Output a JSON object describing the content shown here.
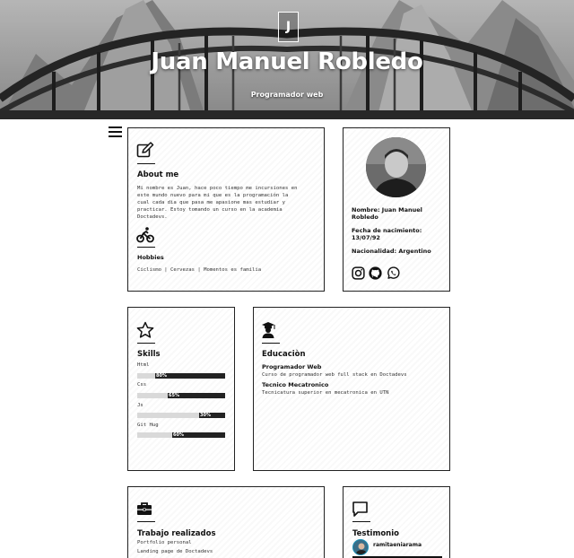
{
  "hero": {
    "logo_letter": "J",
    "title": "Juan Manuel Robledo",
    "subtitle": "Programador web"
  },
  "menu": {
    "icon": "hamburger-menu-icon"
  },
  "about": {
    "icon": "pencil-square-icon",
    "title": "About me",
    "text": [
      "Mi nombre es Juan, hace poco tiempo me incursiones en",
      "este mundo nuevo para mi que es la programación la",
      "cual cada dia que pasa me apasione mas estudiar y",
      "practicar. Estoy tomando un curso en la academia",
      "Doctadevs."
    ],
    "hobbies_icon": "bicycle-rider-icon",
    "hobbies_title": "Hobbies",
    "hobbies_text": "Ciclismo | Cervezas | Momentos es familia"
  },
  "profile": {
    "name_label": "Nombre: Juan Manuel",
    "name_label_2": "Robledo",
    "birth_label": "Fecha de nacimiento:",
    "birth_value": "13/07/92",
    "nationality": "Nacionalidad: Argentino",
    "socials": [
      "instagram-icon",
      "github-icon",
      "whatsapp-icon"
    ]
  },
  "skills": {
    "icon": "star-outline-icon",
    "title": "Skills",
    "items": [
      {
        "name": "Html",
        "percent": 80,
        "label": "80%"
      },
      {
        "name": "Css",
        "percent": 65,
        "label": "65%"
      },
      {
        "name": "Js",
        "percent": 30,
        "label": "30%"
      },
      {
        "name": "Git Hug",
        "percent": 60,
        "label": "60%"
      }
    ]
  },
  "education": {
    "icon": "graduate-icon",
    "title": "Educaciòn",
    "items": [
      {
        "title": "Programador Web",
        "desc": "Curso de programador web full stack en Doctadevs"
      },
      {
        "title": "Tecnico Mecatronico",
        "desc": "Tecnicatura superior en mecatronica en UTN"
      }
    ]
  },
  "works": {
    "icon": "briefcase-icon",
    "title": "Trabajo realizados",
    "items": [
      "Portfolio personal",
      "Landing page de Doctadevs"
    ]
  },
  "testimony": {
    "icon": "speech-bubble-icon",
    "title": "Testimonio",
    "user": "ramitaeniarama"
  }
}
